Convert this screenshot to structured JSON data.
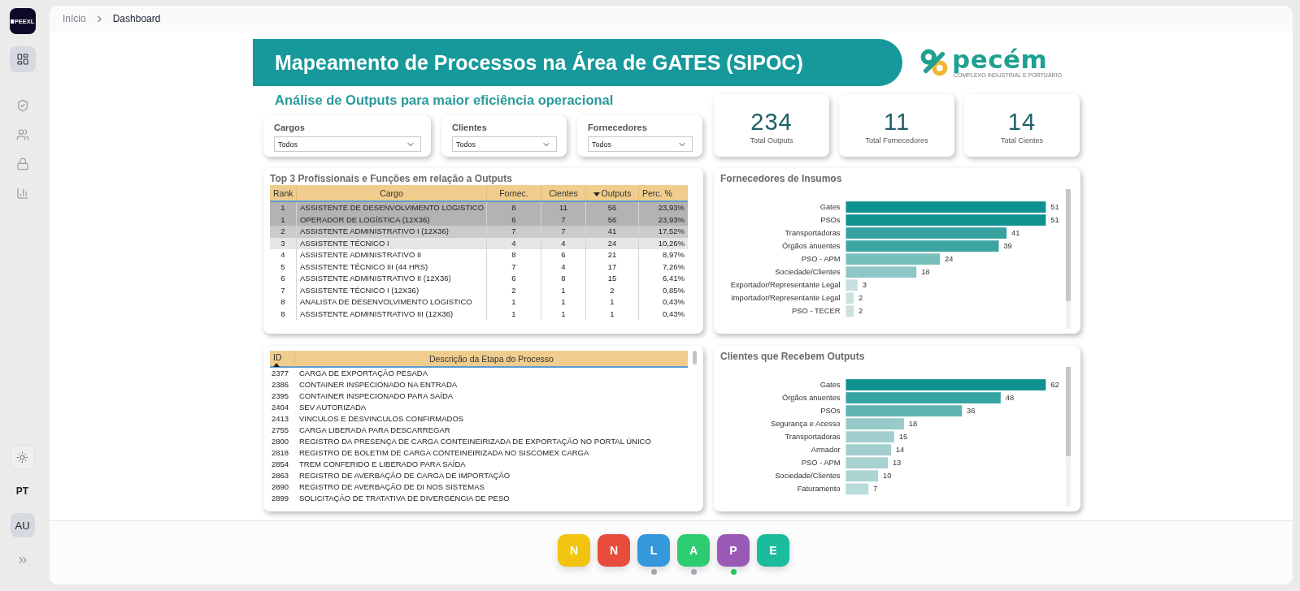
{
  "sidebar": {
    "brand": "PEEXL",
    "nav_items": [
      {
        "selected": true
      },
      {
        "selected": false
      },
      {
        "selected": false
      },
      {
        "selected": false
      },
      {
        "selected": false
      }
    ],
    "language": "PT",
    "user_initials": "AU"
  },
  "breadcrumb": [
    {
      "label": "Início",
      "current": false
    },
    {
      "label": "Dashboard",
      "current": true
    }
  ],
  "banner_title": "Mapeamento de Processos na Área de GATES (SIPOC)",
  "logo": {
    "name": "pecém",
    "tagline": "COMPLEXO INDUSTRIAL E PORTUÁRIO"
  },
  "subtitle": "Análise de Outputs para maior eficiência operacional",
  "slicers": [
    {
      "label": "Cargos",
      "value": "Todos"
    },
    {
      "label": "Clientes",
      "value": "Todos"
    },
    {
      "label": "Fornecedores",
      "value": "Todos"
    }
  ],
  "kpis": [
    {
      "value": "234",
      "label": "Total Outputs"
    },
    {
      "value": "11",
      "label": "Total Fornecedores"
    },
    {
      "value": "14",
      "label": "Total Cientes"
    }
  ],
  "top_table": {
    "title": "Top 3 Profissionais e Funções em relação a Outputs",
    "columns": [
      {
        "label": "Rank"
      },
      {
        "label": "Cargo"
      },
      {
        "label": "Fornec."
      },
      {
        "label": "Cientes"
      },
      {
        "label": "Outputs",
        "sort_descending": true
      },
      {
        "label": "Perc. %"
      }
    ],
    "rows": [
      {
        "cells": [
          "1",
          "ASSISTENTE DE DESENVOLVIMENTO LOGISTICO",
          "8",
          "11",
          "56",
          "23,93%"
        ],
        "color": "#b3b3b3"
      },
      {
        "cells": [
          "1",
          "OPERADOR DE LOGÍSTICA (12X36)",
          "6",
          "7",
          "56",
          "23,93%"
        ],
        "color": "#b3b3b3"
      },
      {
        "cells": [
          "2",
          "ASSISTENTE ADMINISTRATIVO I (12X36)",
          "7",
          "7",
          "41",
          "17,52%"
        ],
        "color": "#cbcbcb"
      },
      {
        "cells": [
          "3",
          "ASSISTENTE TÉCNICO I",
          "4",
          "4",
          "24",
          "10,26%"
        ],
        "color": "#e6e6e6"
      },
      {
        "cells": [
          "4",
          "ASSISTENTE ADMINISTRATIVO II",
          "8",
          "6",
          "21",
          "8,97%"
        ],
        "color": "#ffffff"
      },
      {
        "cells": [
          "5",
          "ASSISTENTE TÉCNICO III (44 HRS)",
          "7",
          "4",
          "17",
          "7,26%"
        ],
        "color": "#ffffff"
      },
      {
        "cells": [
          "6",
          "ASSISTENTE ADMINISTRATIVO II (12X36)",
          "6",
          "8",
          "15",
          "6,41%"
        ],
        "color": "#ffffff"
      },
      {
        "cells": [
          "7",
          "ASSISTENTE TÉCNICO I (12X36)",
          "2",
          "1",
          "2",
          "0,85%"
        ],
        "color": "#ffffff"
      },
      {
        "cells": [
          "8",
          "ANALISTA DE DESENVOLVIMENTO LOGISTICO",
          "1",
          "1",
          "1",
          "0,43%"
        ],
        "color": "#ffffff"
      },
      {
        "cells": [
          "8",
          "ASSISTENTE ADMINISTRATIVO III (12X36)",
          "1",
          "1",
          "1",
          "0,43%"
        ],
        "color": "#ffffff"
      }
    ]
  },
  "process_table": {
    "columns": [
      {
        "label": "ID",
        "sort_ascending": true
      },
      {
        "label": "Descrição da Etapa do Processo"
      }
    ],
    "rows": [
      [
        "2377",
        "CARGA DE EXPORTAÇÃO PESADA"
      ],
      [
        "2386",
        "CONTAINER INSPECIONADO NA ENTRADA"
      ],
      [
        "2395",
        "CONTAINER INSPECIONADO PARA SAÍDA"
      ],
      [
        "2404",
        "SEV AUTORIZADA"
      ],
      [
        "2413",
        "VINCULOS E DESVINCULOS CONFIRMADOS"
      ],
      [
        "2755",
        "CARGA LIBERADA PARA DESCARREGAR"
      ],
      [
        "2800",
        "REGISTRO DA PRESENÇA DE CARGA CONTEINEIRIZADA DE EXPORTAÇÃO NO PORTAL ÚNICO"
      ],
      [
        "2818",
        "REGISTRO DE BOLETIM DE CARGA CONTEINEIRIZADA NO SISCOMEX CARGA"
      ],
      [
        "2854",
        "TREM CONFERIDO E LIBERADO PARA SAÍDA"
      ],
      [
        "2863",
        "REGISTRO DE AVERBAÇÃO DE CARGA DE IMPORTAÇÃO"
      ],
      [
        "2890",
        "REGISTRO DE AVERBAÇÃO DE DI NOS SISTEMAS"
      ],
      [
        "2899",
        "SOLICITAÇÃO DE TRATATIVA DE DIVERGENCIA DE PESO"
      ]
    ]
  },
  "suppliers_chart": {
    "chart_data": {
      "type": "bar",
      "title": "Fornecedores de Insumos",
      "orientation": "horizontal",
      "categories": [
        "Gates",
        "PSOs",
        "Transportadoras",
        "Órgãos anuentes",
        "PSO - APM",
        "Sociedade/Clientes",
        "Exportador/Representante Legal",
        "Importador/Representante Legal",
        "PSO - TECER"
      ],
      "series": [
        {
          "color": "#0e918f",
          "values": [
            51,
            51,
            null,
            null,
            null,
            null,
            null,
            null,
            null
          ]
        },
        {
          "color": "#35a2a0",
          "values": [
            null,
            null,
            41,
            null,
            null,
            null,
            null,
            null,
            null
          ]
        },
        {
          "color": "#3ba5a3",
          "values": [
            null,
            null,
            null,
            39,
            null,
            null,
            null,
            null,
            null
          ]
        },
        {
          "color": "#75bfbd",
          "values": [
            null,
            null,
            null,
            null,
            24,
            null,
            null,
            null,
            null
          ]
        },
        {
          "color": "#8ec8c6",
          "values": [
            null,
            null,
            null,
            null,
            null,
            18,
            null,
            null,
            null
          ]
        },
        {
          "color": "#c6dfde",
          "values": [
            null,
            null,
            null,
            null,
            null,
            null,
            3,
            null,
            null
          ]
        },
        {
          "color": "#cae1e0",
          "values": [
            null,
            null,
            null,
            null,
            null,
            null,
            null,
            2,
            2
          ]
        }
      ],
      "data_labels": true
    }
  },
  "clients_chart": {
    "chart_data": {
      "type": "bar",
      "title": "Clientes que Recebem Outputs",
      "orientation": "horizontal",
      "categories": [
        "Gates",
        "Órgãos anuentes",
        "PSOs",
        "Segurança e Acesso",
        "Transportadoras",
        "Armador",
        "PSO - APM",
        "Sociedade/Clientes",
        "Faturamento"
      ],
      "series": [
        {
          "color": "#0e918f",
          "values": [
            62,
            null,
            null,
            null,
            null,
            null,
            null,
            null,
            null
          ]
        },
        {
          "color": "#36a4a2",
          "values": [
            null,
            48,
            null,
            null,
            null,
            null,
            null,
            null,
            null
          ]
        },
        {
          "color": "#5fb3b1",
          "values": [
            null,
            null,
            36,
            null,
            null,
            null,
            null,
            null,
            null
          ]
        },
        {
          "color": "#97cac8",
          "values": [
            null,
            null,
            null,
            18,
            null,
            null,
            null,
            null,
            null
          ]
        },
        {
          "color": "#a2cfcd",
          "values": [
            null,
            null,
            null,
            null,
            15,
            14,
            null,
            null,
            null
          ]
        },
        {
          "color": "#a6d1cf",
          "values": [
            null,
            null,
            null,
            null,
            null,
            null,
            13,
            null,
            null
          ]
        },
        {
          "color": "#add4d3",
          "values": [
            null,
            null,
            null,
            null,
            null,
            null,
            null,
            10,
            null
          ]
        },
        {
          "color": "#b9dbda",
          "values": [
            null,
            null,
            null,
            null,
            null,
            null,
            null,
            null,
            7
          ]
        }
      ],
      "data_labels": true
    }
  },
  "app_switcher": [
    {
      "label": "N",
      "color": "#f1c40f"
    },
    {
      "label": "N",
      "color": "#e74c3c"
    },
    {
      "label": "L",
      "color": "#3498db",
      "status_dot": {
        "color": "#a3a6b1"
      }
    },
    {
      "label": "A",
      "color": "#2ecc71",
      "status_dot": {
        "color": "#a3a6b1"
      }
    },
    {
      "label": "P",
      "color": "#9b59b6",
      "status_dot": {
        "color": "#22c55e"
      }
    },
    {
      "label": "E",
      "color": "#1abc9c"
    }
  ]
}
